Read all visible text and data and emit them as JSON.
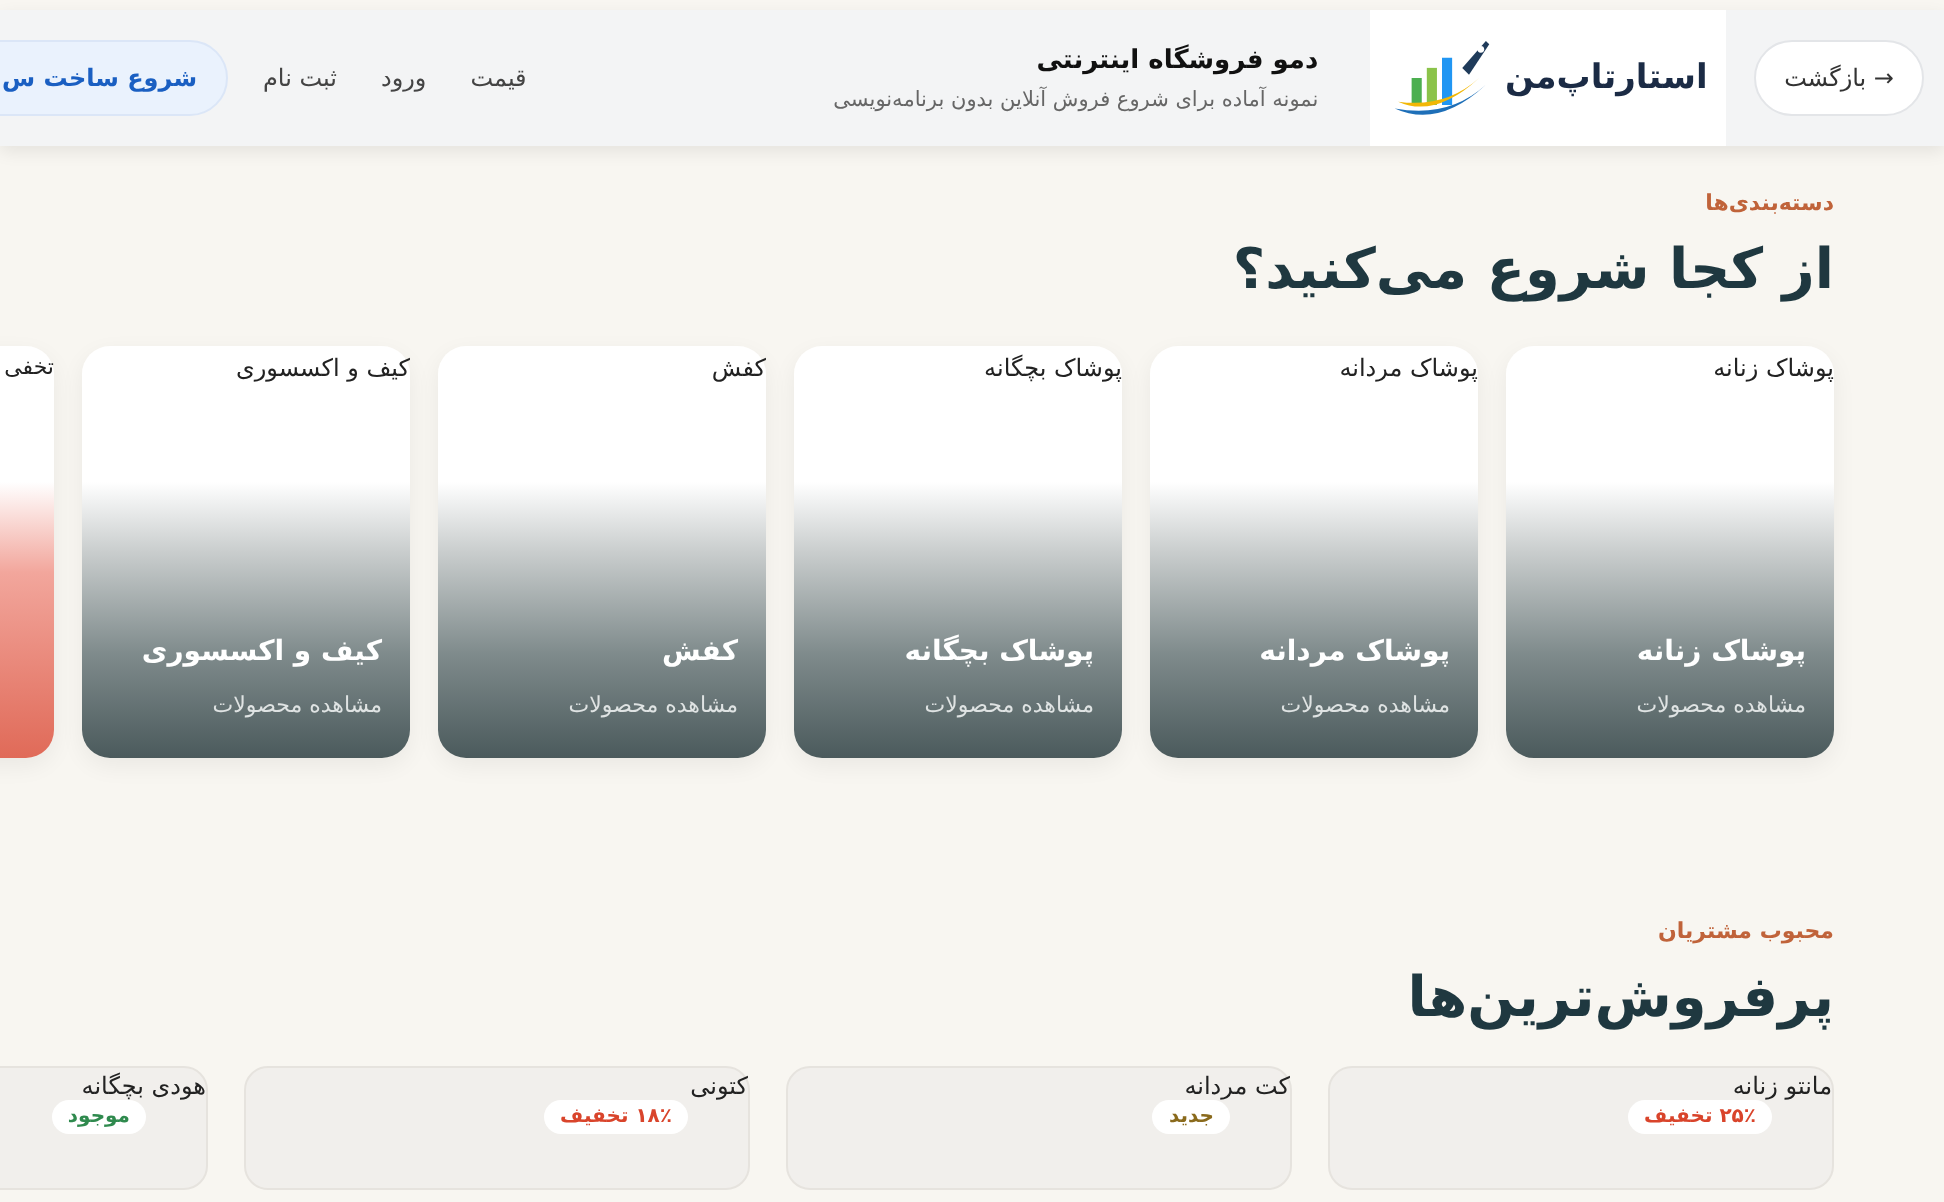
{
  "header": {
    "back_button": "→ بازگشت",
    "logo_text": "استارتاپ‌من",
    "title": "دمو فروشگاه اینترنتی",
    "subtitle": "نمونه آماده برای شروع فروش آنلاین بدون برنامه‌نویسی",
    "nav": [
      "قیمت",
      "ورود",
      "ثبت نام"
    ],
    "cta": "شروع ساخت س"
  },
  "categories": {
    "eyebrow": "دسته‌بندی‌ها",
    "heading": "از کجا شروع می‌کنید؟",
    "cards": [
      {
        "kind": "category",
        "label": "پوشاک زنانه",
        "title": "پوشاک زنانه",
        "link": "مشاهده محصولات"
      },
      {
        "kind": "category",
        "label": "پوشاک مردانه",
        "title": "پوشاک مردانه",
        "link": "مشاهده محصولات"
      },
      {
        "kind": "category",
        "label": "پوشاک بچگانه",
        "title": "پوشاک بچگانه",
        "link": "مشاهده محصولات"
      },
      {
        "kind": "category",
        "label": "کفش",
        "title": "کفش",
        "link": "مشاهده محصولات"
      },
      {
        "kind": "category",
        "label": "کیف و اکسسوری",
        "title": "کیف و اکسسوری",
        "link": "مشاهده محصولات"
      },
      {
        "kind": "sale",
        "label": "تخفی"
      }
    ]
  },
  "bestsellers": {
    "eyebrow": "محبوب مشتریان",
    "heading": "پرفروش‌ترین‌ها",
    "products": [
      {
        "name": "مانتو زنانه",
        "badge": {
          "kind": "discount",
          "text": "۲۵٪ تخفیف"
        }
      },
      {
        "name": "کت مردانه",
        "badge": {
          "kind": "new",
          "text": "جدید"
        }
      },
      {
        "name": "کتونی",
        "badge": {
          "kind": "discount",
          "text": "۱۸٪ تخفیف"
        }
      },
      {
        "name": "هودی بچگانه",
        "badge": {
          "kind": "stock",
          "text": "موجود"
        }
      }
    ]
  }
}
